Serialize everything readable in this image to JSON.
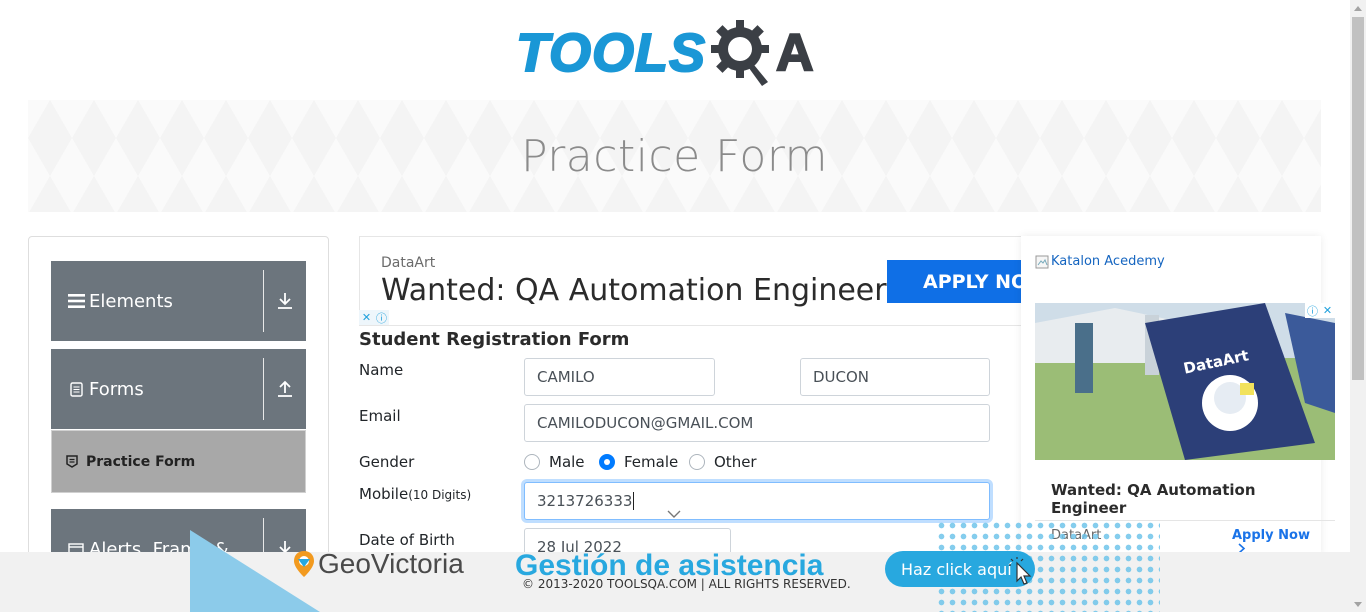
{
  "logo": {
    "tools": "TOOLS",
    "qa_letter": "A"
  },
  "banner": {
    "title": "Practice Form"
  },
  "sidebar": {
    "groups": [
      {
        "label": "Elements",
        "icon": "menu-icon",
        "arrow": "download-arrow-icon"
      },
      {
        "label": "Forms",
        "icon": "document-icon",
        "arrow": "upload-arrow-icon"
      },
      {
        "label": "Alerts, Frame &",
        "icon": "window-icon",
        "arrow": "download-arrow-icon"
      }
    ],
    "active_item": {
      "label": "Practice Form",
      "icon": "form-icon"
    }
  },
  "top_ad": {
    "advertiser": "DataArt",
    "headline": "Wanted: QA Automation Engineer",
    "cta": "APPLY NOW"
  },
  "form": {
    "title": "Student Registration Form",
    "labels": {
      "name": "Name",
      "email": "Email",
      "gender": "Gender",
      "mobile": "Mobile",
      "mobile_hint": "(10 Digits)",
      "dob": "Date of Birth"
    },
    "first_name": "CAMILO",
    "last_name": "DUCON",
    "email": "CAMILODUCON@GMAIL.COM",
    "gender_options": [
      "Male",
      "Female",
      "Other"
    ],
    "gender_selected": "Female",
    "mobile": "3213726333",
    "dob": "28 Jul 2022"
  },
  "right_ad": {
    "broken_image_alt": "Katalon Acedemy",
    "headline": "Wanted: QA Automation Engineer",
    "advertiser": "DataArt",
    "cta": "Apply Now",
    "poster_text": "DataArt"
  },
  "bottom_ad": {
    "brand": "GeoVictoria",
    "tagline": "Gestión de asistencia",
    "cta": "Haz click aquí"
  },
  "footer": {
    "copyright": "© 2013-2020 TOOLSQA.COM | ALL RIGHTS RESERVED."
  },
  "colors": {
    "accent": "#1a97d6",
    "sidebar_group": "#6c757d",
    "active_item": "#a8a8a8",
    "radio_on": "#007bff",
    "ad_blue": "#28a8df"
  }
}
